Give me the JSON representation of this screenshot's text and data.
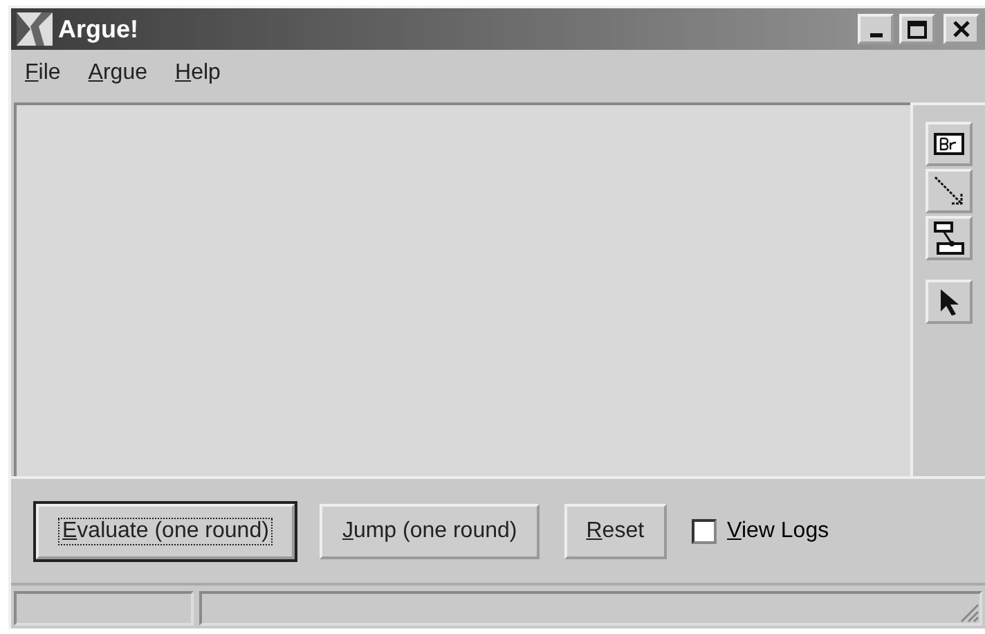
{
  "window": {
    "title": "Argue!"
  },
  "menu": [
    {
      "label": "File",
      "mnemonic": true
    },
    {
      "label": "Argue",
      "mnemonic": true
    },
    {
      "label": "Help",
      "mnemonic": true
    }
  ],
  "tools": [
    {
      "kind": "box"
    },
    {
      "kind": "arrow"
    },
    {
      "kind": "link"
    },
    {
      "kind": "pointer"
    }
  ],
  "buttons": [
    {
      "label": "Evaluate (one round)",
      "focused": true,
      "mnemonic": true
    },
    {
      "label": "Jump (one round)",
      "focused": false,
      "mnemonic": true
    },
    {
      "label": "Reset",
      "focused": false,
      "mnemonic": true
    }
  ],
  "view_logs": {
    "label": "View Logs",
    "checked": false,
    "mnemonic": true
  }
}
